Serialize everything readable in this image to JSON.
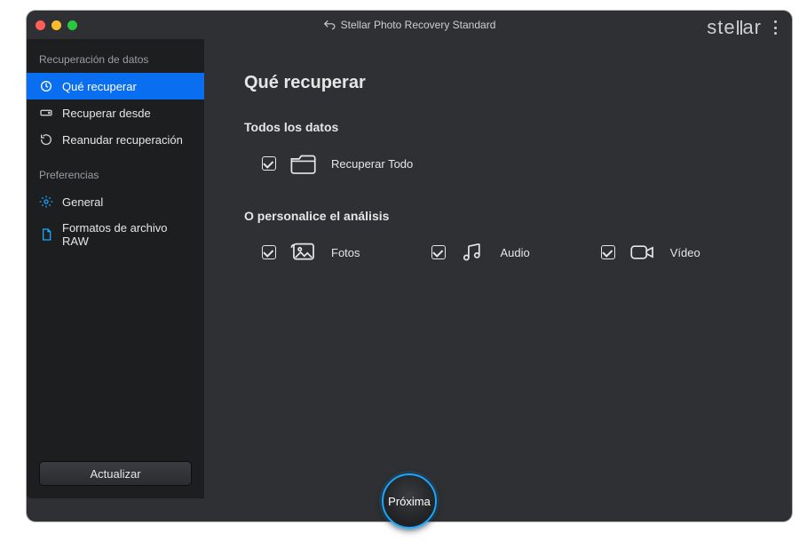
{
  "titlebar": {
    "app_title": "Stellar Photo Recovery Standard",
    "brand": "stellar"
  },
  "sidebar": {
    "sections": [
      {
        "title": "Recuperación de datos",
        "items": [
          {
            "label": "Qué recuperar",
            "active": true
          },
          {
            "label": "Recuperar desde",
            "active": false
          },
          {
            "label": "Reanudar recuperación",
            "active": false
          }
        ]
      },
      {
        "title": "Preferencias",
        "items": [
          {
            "label": "General",
            "active": false
          },
          {
            "label": "Formatos de archivo RAW",
            "active": false
          }
        ]
      }
    ],
    "update_button": "Actualizar"
  },
  "main": {
    "heading": "Qué recuperar",
    "all_section": {
      "title": "Todos los datos",
      "option": {
        "label": "Recuperar Todo",
        "checked": true
      }
    },
    "custom_section": {
      "title": "O personalice el análisis",
      "options": [
        {
          "label": "Fotos",
          "checked": true
        },
        {
          "label": "Audio",
          "checked": true
        },
        {
          "label": "Vídeo",
          "checked": true
        }
      ]
    },
    "next_button": "Próxima"
  }
}
